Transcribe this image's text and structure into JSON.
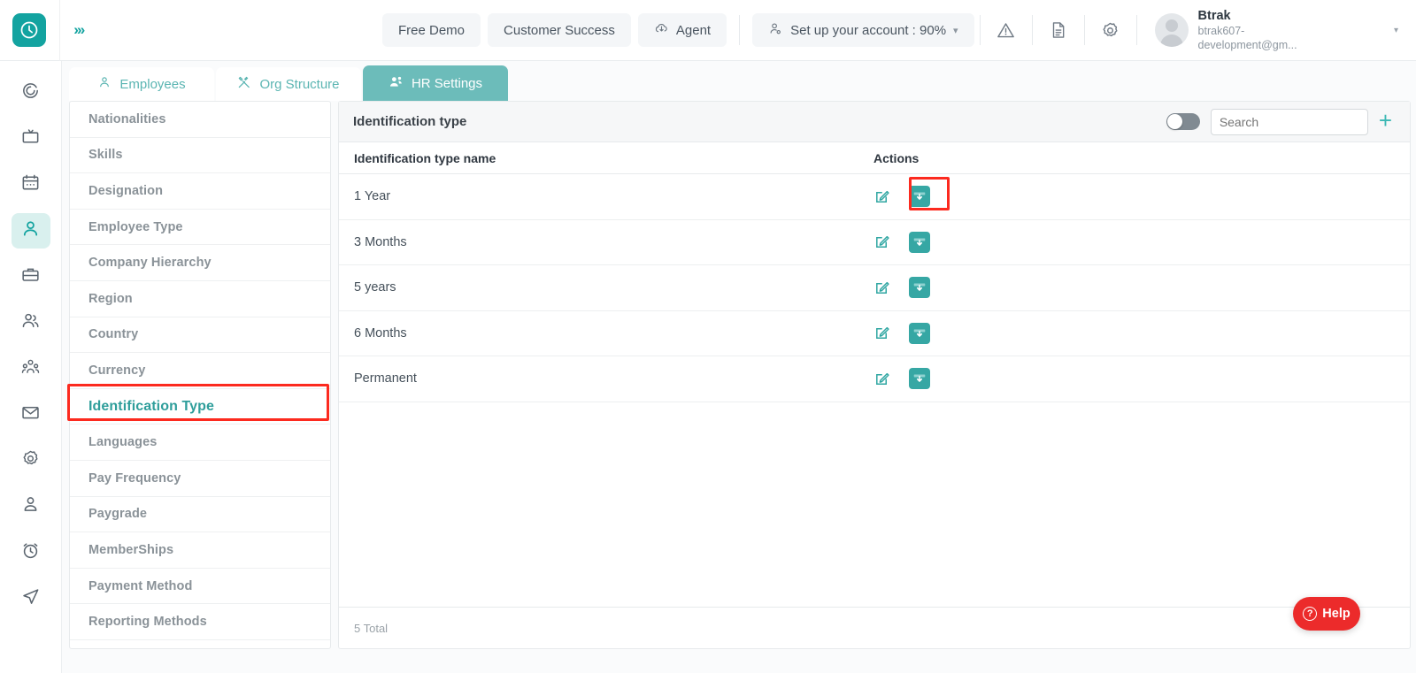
{
  "topbar": {
    "logo_icon": "clock-logo-icon",
    "expand_icon": "double-chevron-right-icon",
    "nav_buttons": [
      {
        "label": "Free Demo",
        "icon": ""
      },
      {
        "label": "Customer Success",
        "icon": ""
      },
      {
        "label": "Agent",
        "icon": "cloud-download-icon"
      }
    ],
    "account_setup": {
      "label": "Set up your account : 90%",
      "icon": "user-gear-icon",
      "caret": "▾"
    },
    "icons": [
      {
        "name": "warning-triangle-icon",
        "glyph": "⚠"
      },
      {
        "name": "document-icon",
        "glyph": "🗎"
      },
      {
        "name": "gear-icon",
        "glyph": "⚙"
      }
    ],
    "profile": {
      "name": "Btrak",
      "email": "btrak607-development@gm...",
      "caret": "▾"
    }
  },
  "rail": {
    "items": [
      {
        "name": "spiral-target-icon",
        "active": false
      },
      {
        "name": "tv-monitor-icon",
        "active": false
      },
      {
        "name": "calendar-icon",
        "active": false
      },
      {
        "name": "person-icon",
        "active": true
      },
      {
        "name": "briefcase-icon",
        "active": false
      },
      {
        "name": "two-people-icon",
        "active": false
      },
      {
        "name": "org-group-icon",
        "active": false
      },
      {
        "name": "envelope-icon",
        "active": false
      },
      {
        "name": "gear-icon",
        "active": false
      },
      {
        "name": "user-account-icon",
        "active": false
      },
      {
        "name": "alarm-clock-icon",
        "active": false
      },
      {
        "name": "send-navigate-icon",
        "active": false
      }
    ]
  },
  "tabs": [
    {
      "label": "Employees",
      "icon": "person-icon",
      "active": false
    },
    {
      "label": "Org Structure",
      "icon": "tools-icon",
      "active": false
    },
    {
      "label": "HR Settings",
      "icon": "people-gear-icon",
      "active": true
    }
  ],
  "settings_menu": {
    "items": [
      {
        "label": "Nationalities",
        "selected": false
      },
      {
        "label": "Skills",
        "selected": false
      },
      {
        "label": "Designation",
        "selected": false
      },
      {
        "label": "Employee Type",
        "selected": false
      },
      {
        "label": "Company Hierarchy",
        "selected": false
      },
      {
        "label": "Region",
        "selected": false
      },
      {
        "label": "Country",
        "selected": false
      },
      {
        "label": "Currency",
        "selected": false
      },
      {
        "label": "Identification Type",
        "selected": true
      },
      {
        "label": "Languages",
        "selected": false
      },
      {
        "label": "Pay Frequency",
        "selected": false
      },
      {
        "label": "Paygrade",
        "selected": false
      },
      {
        "label": "MemberShips",
        "selected": false
      },
      {
        "label": "Payment Method",
        "selected": false
      },
      {
        "label": "Reporting Methods",
        "selected": false
      }
    ]
  },
  "panel": {
    "title": "Identification type",
    "toggle_state": "off",
    "search_placeholder": "Search",
    "search_value": "",
    "add_label": "+",
    "columns": {
      "name": "Identification type name",
      "actions": "Actions"
    },
    "rows": [
      {
        "name": "1 Year"
      },
      {
        "name": "3 Months"
      },
      {
        "name": "5 years"
      },
      {
        "name": "6 Months"
      },
      {
        "name": "Permanent"
      }
    ],
    "footer_total": "5 Total",
    "row_action_icons": {
      "edit": "edit-pencil-icon",
      "archive": "archive-download-icon"
    }
  },
  "help": {
    "label": "Help",
    "icon": "question-circle-icon"
  },
  "colors": {
    "teal": "#13a3a0",
    "teal_tab": "#6cbcba",
    "teal_action": "#36a7a4",
    "highlight_red": "#fc2a1f",
    "help_red": "#ec2b2b",
    "panel_bg": "#fafbfc"
  }
}
